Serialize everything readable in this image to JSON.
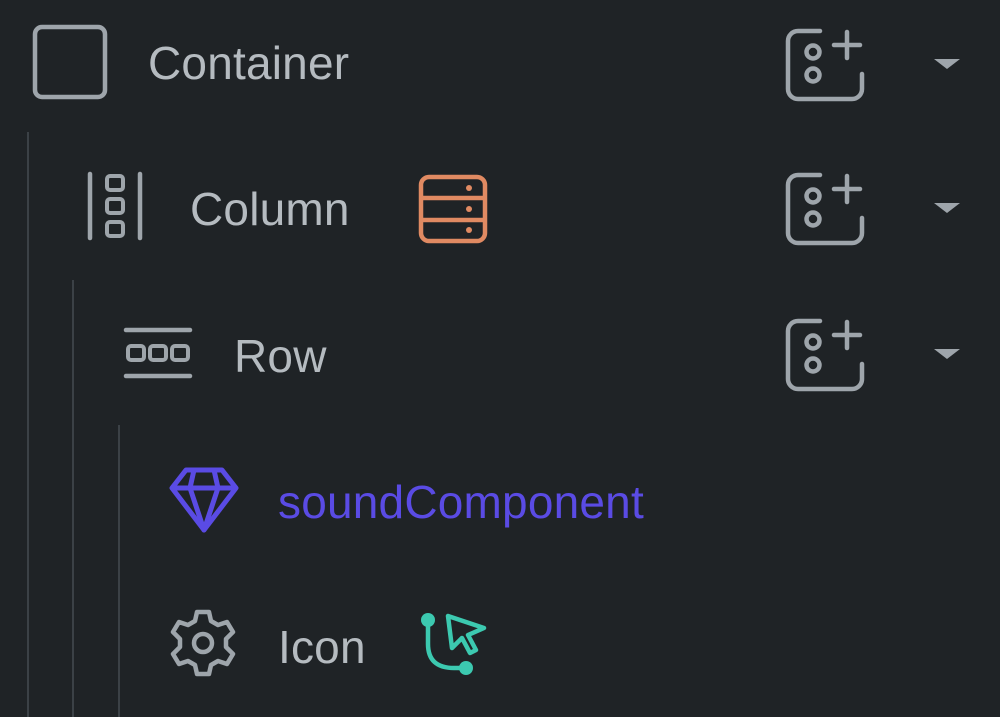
{
  "tree": {
    "nodes": [
      {
        "label": "Container",
        "icon": "square-outline-icon",
        "type": "widget"
      },
      {
        "label": "Column",
        "icon": "column-layout-icon",
        "badge": "server-stack-icon",
        "type": "widget"
      },
      {
        "label": "Row",
        "icon": "row-layout-icon",
        "type": "widget"
      },
      {
        "label": "soundComponent",
        "icon": "gem-icon",
        "type": "component"
      },
      {
        "label": "Icon",
        "icon": "gear-icon",
        "badge": "branch-cursor-icon",
        "type": "widget"
      }
    ],
    "add_child_icon": "add-child-icon",
    "expand_icon": "caret-down-icon"
  },
  "colors": {
    "background": "#1f2326",
    "text": "#b5bbc0",
    "guide": "#3b4146",
    "component_accent": "#5a4be4",
    "badge_orange": "#e08a62",
    "badge_teal": "#3cc9b0"
  }
}
